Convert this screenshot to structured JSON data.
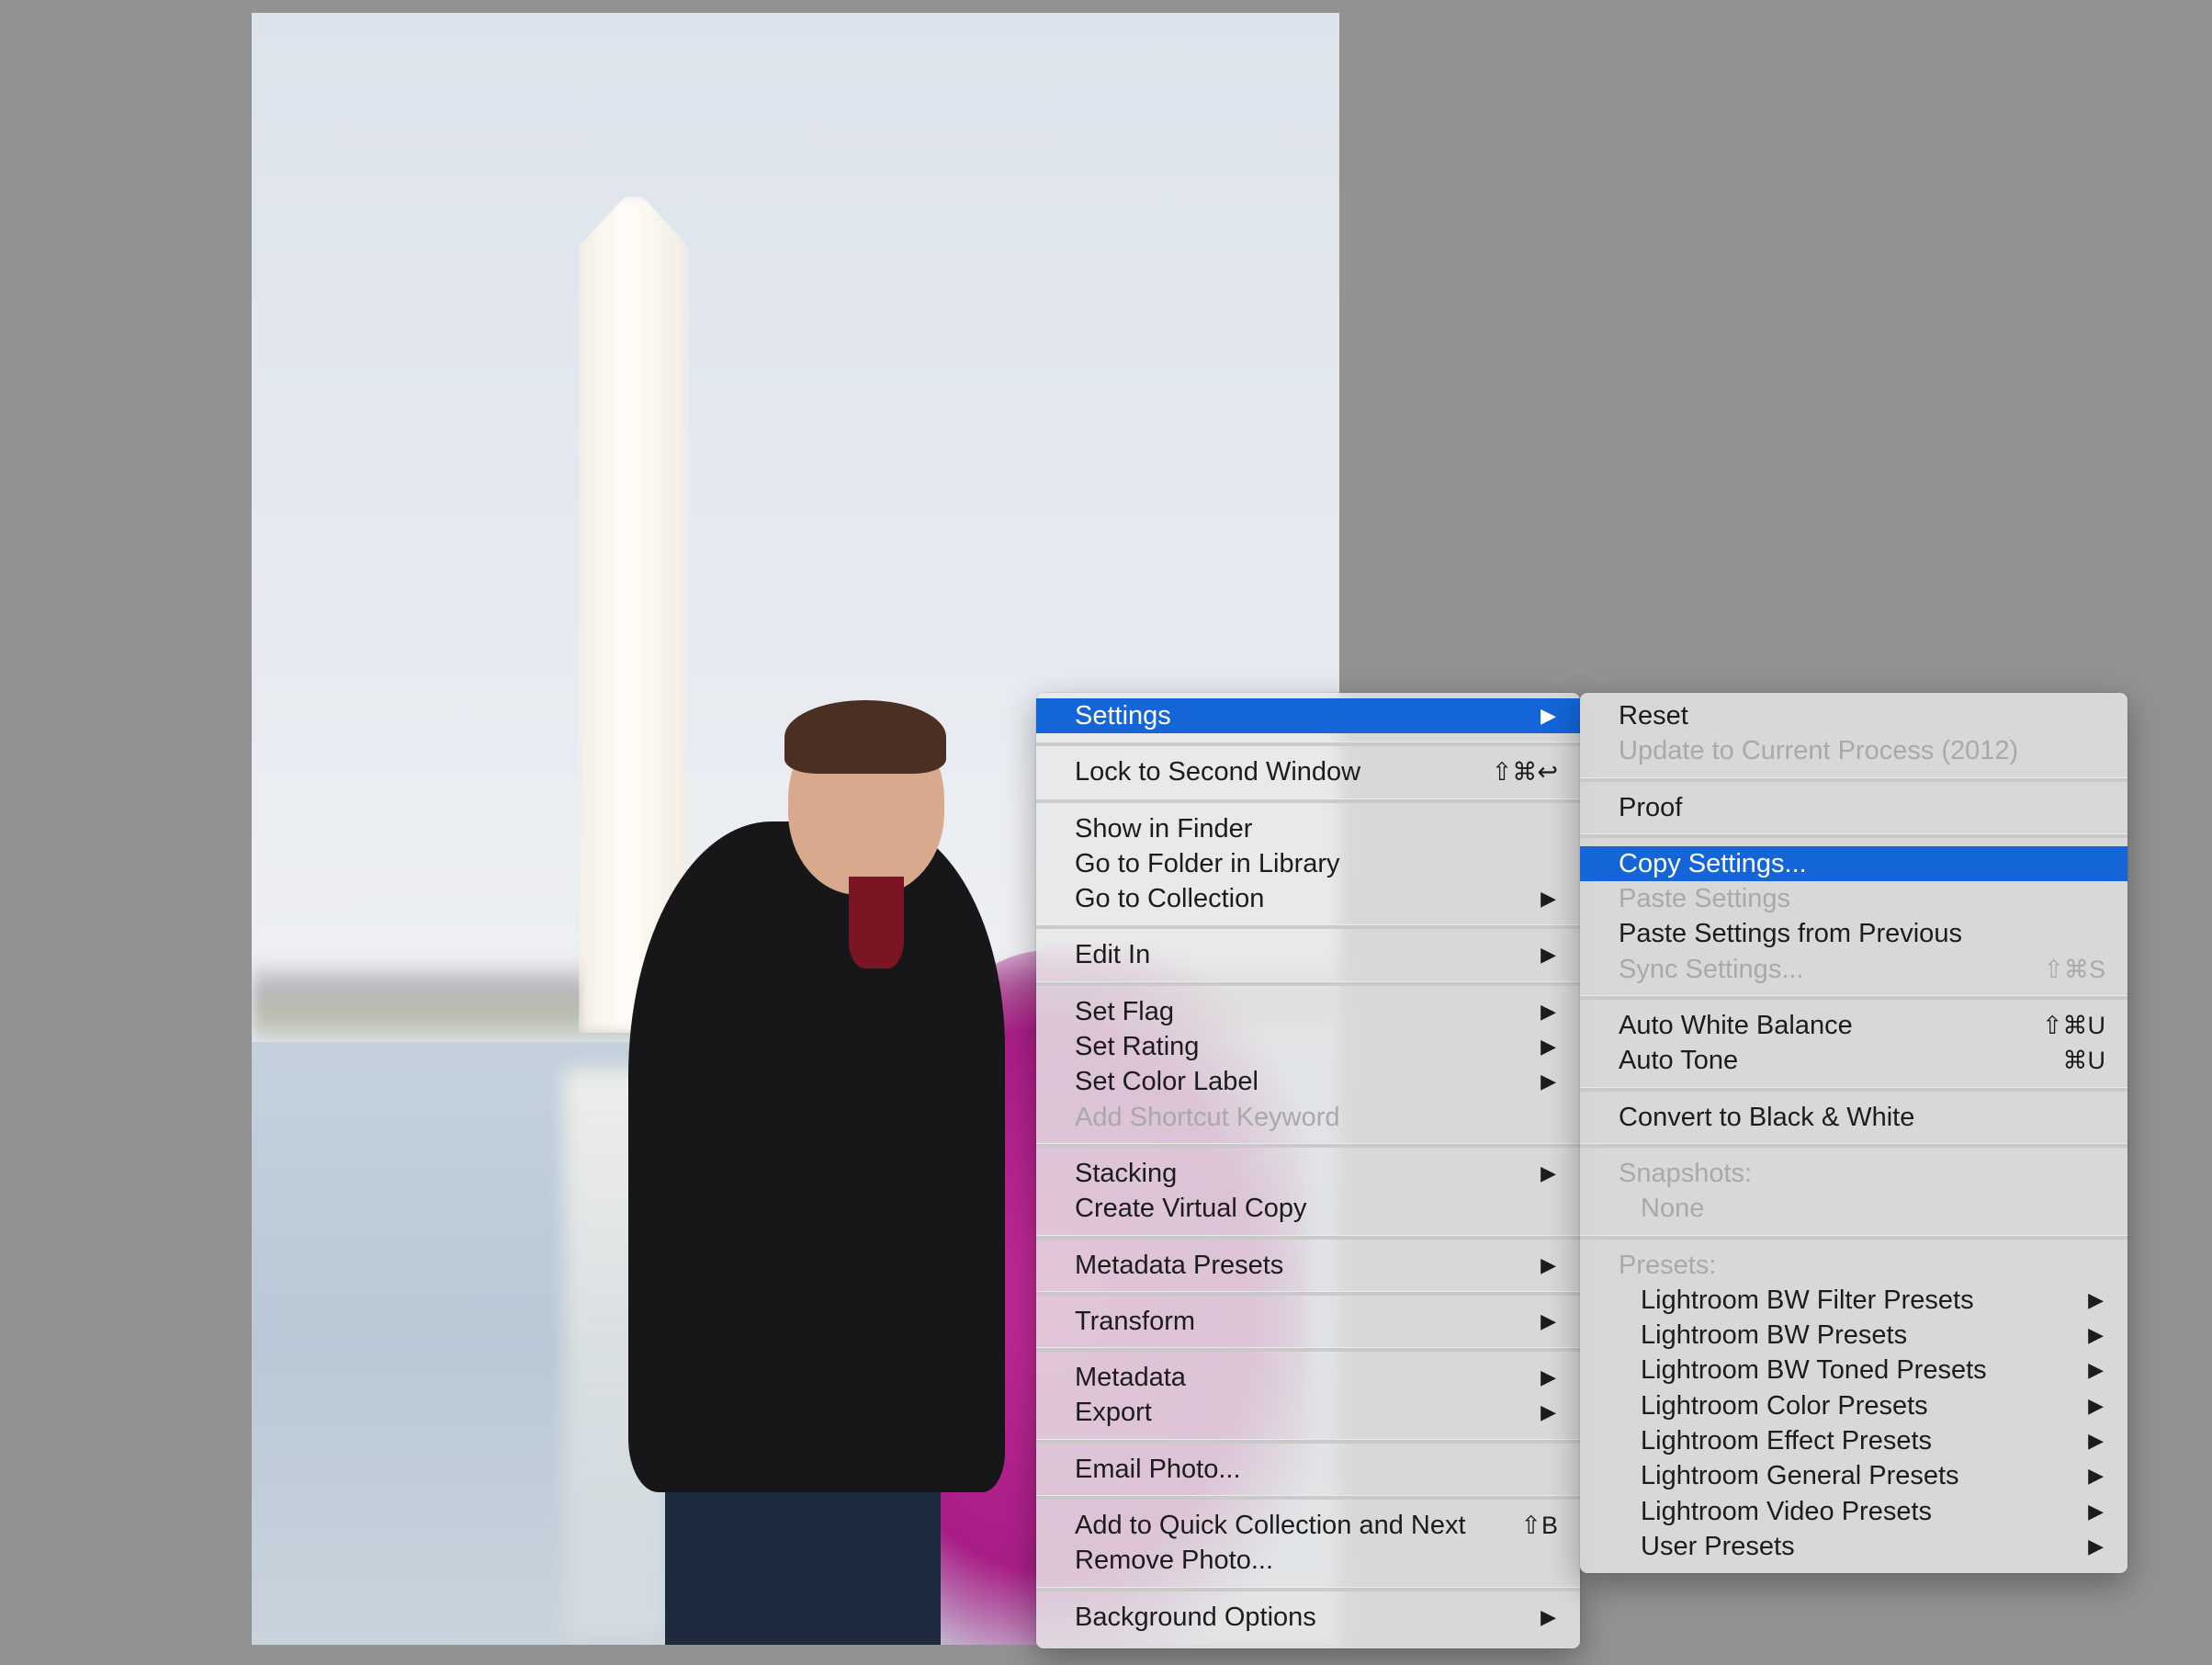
{
  "menu": {
    "groups": [
      [
        {
          "label": "Settings",
          "submenu": true,
          "highlighted": true
        }
      ],
      [
        {
          "label": "Lock to Second Window",
          "shortcut": "⇧⌘↩"
        }
      ],
      [
        {
          "label": "Show in Finder"
        },
        {
          "label": "Go to Folder in Library"
        },
        {
          "label": "Go to Collection",
          "submenu": true
        }
      ],
      [
        {
          "label": "Edit In",
          "submenu": true
        }
      ],
      [
        {
          "label": "Set Flag",
          "submenu": true
        },
        {
          "label": "Set Rating",
          "submenu": true
        },
        {
          "label": "Set Color Label",
          "submenu": true
        },
        {
          "label": "Add Shortcut Keyword",
          "disabled": true
        }
      ],
      [
        {
          "label": "Stacking",
          "submenu": true
        },
        {
          "label": "Create Virtual Copy"
        }
      ],
      [
        {
          "label": "Metadata Presets",
          "submenu": true
        }
      ],
      [
        {
          "label": "Transform",
          "submenu": true
        }
      ],
      [
        {
          "label": "Metadata",
          "submenu": true
        },
        {
          "label": "Export",
          "submenu": true
        }
      ],
      [
        {
          "label": "Email Photo..."
        }
      ],
      [
        {
          "label": "Add to Quick Collection and Next",
          "shortcut": "⇧B"
        },
        {
          "label": "Remove Photo..."
        }
      ],
      [
        {
          "label": "Background Options",
          "submenu": true
        }
      ]
    ]
  },
  "submenu": {
    "groups": [
      [
        {
          "label": "Reset"
        },
        {
          "label": "Update to Current Process (2012)",
          "disabled": true
        }
      ],
      [
        {
          "label": "Proof"
        }
      ],
      [
        {
          "label": "Copy Settings...",
          "highlighted": true
        },
        {
          "label": "Paste Settings",
          "disabled": true
        },
        {
          "label": "Paste Settings from Previous"
        },
        {
          "label": "Sync Settings...",
          "disabled": true,
          "shortcut": "⇧⌘S"
        }
      ],
      [
        {
          "label": "Auto White Balance",
          "shortcut": "⇧⌘U"
        },
        {
          "label": "Auto Tone",
          "shortcut": "⌘U"
        }
      ],
      [
        {
          "label": "Convert to Black & White"
        }
      ],
      [
        {
          "label": "Snapshots:",
          "disabled": true
        },
        {
          "label": "None",
          "disabled": true,
          "indent": true
        }
      ],
      [
        {
          "label": "Presets:",
          "disabled": true
        },
        {
          "label": "Lightroom BW Filter Presets",
          "indent": true,
          "submenu": true
        },
        {
          "label": "Lightroom BW Presets",
          "indent": true,
          "submenu": true
        },
        {
          "label": "Lightroom BW Toned Presets",
          "indent": true,
          "submenu": true
        },
        {
          "label": "Lightroom Color Presets",
          "indent": true,
          "submenu": true
        },
        {
          "label": "Lightroom Effect Presets",
          "indent": true,
          "submenu": true
        },
        {
          "label": "Lightroom General Presets",
          "indent": true,
          "submenu": true
        },
        {
          "label": "Lightroom Video Presets",
          "indent": true,
          "submenu": true
        },
        {
          "label": "User Presets",
          "indent": true,
          "submenu": true
        }
      ]
    ]
  },
  "icons": {
    "submenu_arrow": "triangle-right"
  },
  "colors": {
    "highlight": "#1365d8",
    "background": "#929292",
    "disabled_text": "#a9a9a9"
  }
}
